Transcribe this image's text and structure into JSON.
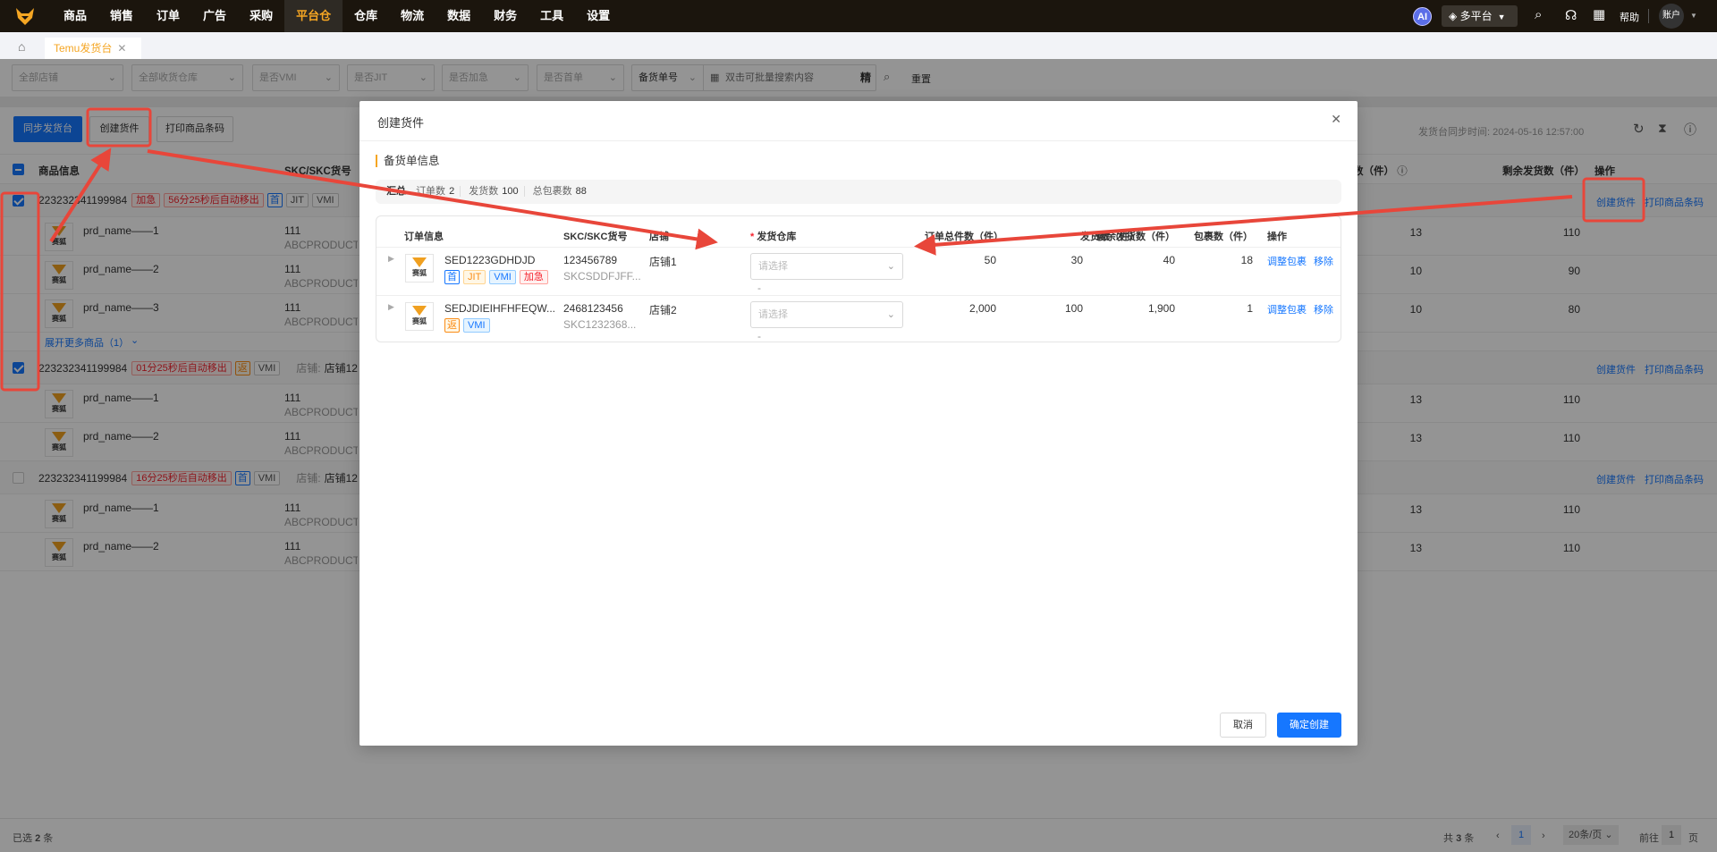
{
  "nav": {
    "logo": "saihu-fox-logo",
    "items": [
      "商品",
      "销售",
      "订单",
      "广告",
      "采购",
      "平台仓",
      "仓库",
      "物流",
      "数据",
      "财务",
      "工具",
      "设置"
    ],
    "active": "平台仓",
    "ai": "AI",
    "platform": "多平台",
    "help": "帮助",
    "account": "账户",
    "icons": [
      "search-icon",
      "headset-icon",
      "grid-icon"
    ]
  },
  "tabs": {
    "items": [
      {
        "label": "Temu发货台"
      }
    ]
  },
  "filters": {
    "shop": "全部店铺",
    "warehouse": "全部收货仓库",
    "vmi": "是否VMI",
    "jit": "是否JIT",
    "urgent": "是否加急",
    "first": "是否首单",
    "search_type": "备货单号",
    "search_placeholder": "双击可批量搜索内容",
    "exact": "精",
    "reset": "重置"
  },
  "toolbar": {
    "sync": "同步发货台",
    "create": "创建货件",
    "print": "打印商品条码",
    "sync_time_label": "发货台同步时间:",
    "sync_time": "2024-05-16 12:57:00"
  },
  "table": {
    "headers": {
      "product": "商品信息",
      "skc": "SKC/SKC货号",
      "ship": "发货数（件）",
      "remaining": "剩余发货数（件）",
      "ops": "操作"
    },
    "thumb_text": "赛狐",
    "groups": [
      {
        "order_id": "223232341199984",
        "checked": true,
        "tags": [
          {
            "text": "加急",
            "type": "red"
          },
          {
            "text": "56分25秒后自动移出",
            "type": "red"
          },
          {
            "text": "首",
            "type": "blue-sq"
          },
          {
            "text": "JIT",
            "type": "gray"
          },
          {
            "text": "VMI",
            "type": "gray"
          }
        ],
        "shop_label": "",
        "shop": "",
        "actions": [
          "创建货件",
          "打印商品条码"
        ],
        "products": [
          {
            "name": "prd_name——1",
            "skc": "111",
            "skc_code": "ABCPRODUCTS",
            "ship": "13",
            "remaining": "110"
          },
          {
            "name": "prd_name——2",
            "skc": "111",
            "skc_code": "ABCPRODUCTS",
            "ship": "10",
            "remaining": "90"
          },
          {
            "name": "prd_name——3",
            "skc": "111",
            "skc_code": "ABCPRODUCTS",
            "ship": "10",
            "remaining": "80"
          }
        ],
        "expand": "展开更多商品（1）"
      },
      {
        "order_id": "223232341199984",
        "checked": true,
        "tags": [
          {
            "text": "01分25秒后自动移出",
            "type": "red"
          },
          {
            "text": "返",
            "type": "orange-sq"
          },
          {
            "text": "VMI",
            "type": "gray"
          }
        ],
        "shop_label": "店铺:",
        "shop": "店铺12",
        "actions": [
          "创建货件",
          "打印商品条码"
        ],
        "products": [
          {
            "name": "prd_name——1",
            "skc": "111",
            "skc_code": "ABCPRODUCTS",
            "ship": "13",
            "remaining": "110"
          },
          {
            "name": "prd_name——2",
            "skc": "111",
            "skc_code": "ABCPRODUCTS",
            "ship": "13",
            "remaining": "110"
          }
        ]
      },
      {
        "order_id": "223232341199984",
        "checked": false,
        "tags": [
          {
            "text": "16分25秒后自动移出",
            "type": "red"
          },
          {
            "text": "首",
            "type": "blue-sq"
          },
          {
            "text": "VMI",
            "type": "gray"
          }
        ],
        "shop_label": "店铺:",
        "shop": "店铺12",
        "actions": [
          "创建货件",
          "打印商品条码"
        ],
        "products": [
          {
            "name": "prd_name——1",
            "skc": "111",
            "skc_code": "ABCPRODUCTS",
            "ship": "13",
            "remaining": "110"
          },
          {
            "name": "prd_name——2",
            "skc": "111",
            "skc_code": "ABCPRODUCTS",
            "ship": "13",
            "remaining": "110"
          }
        ]
      }
    ]
  },
  "footer": {
    "selected_prefix": "已选",
    "selected": "2",
    "selected_suffix": "条",
    "total_prefix": "共",
    "total": "3",
    "total_suffix": "条",
    "page": "1",
    "page_size": "20条/页",
    "goto": "前往",
    "goto_page": "1",
    "page_suffix": "页"
  },
  "modal": {
    "title": "创建货件",
    "section": "备货单信息",
    "summary": {
      "label": "汇总",
      "items": [
        {
          "label": "订单数",
          "value": "2"
        },
        {
          "label": "发货数",
          "value": "100"
        },
        {
          "label": "总包裹数",
          "value": "88"
        }
      ]
    },
    "headers": {
      "order": "订单信息",
      "skc": "SKC/SKC货号",
      "shop": "店铺",
      "warehouse_required": "*",
      "warehouse": "发货仓库",
      "total": "订单总件数（件）",
      "ship": "发货数（件）",
      "remaining": "剩余发货数（件）",
      "packages": "包裹数（件）",
      "ops": "操作"
    },
    "rows": [
      {
        "order": "SED1223GDHDJD",
        "tags": [
          {
            "text": "首",
            "type": "blue-sq"
          },
          {
            "text": "JIT",
            "type": "orange"
          },
          {
            "text": "VMI",
            "type": "blue"
          },
          {
            "text": "加急",
            "type": "red"
          }
        ],
        "skc": "123456789",
        "skc_code": "SKCSDDFJFF...",
        "shop": "店铺1",
        "warehouse_placeholder": "请选择",
        "warehouse_note": "-",
        "total": "50",
        "ship": "30",
        "remaining": "40",
        "packages": "18",
        "actions": [
          "调整包裹",
          "移除"
        ]
      },
      {
        "order": "SEDJDIEIHFHFEQW...",
        "tags": [
          {
            "text": "返",
            "type": "orange-sq"
          },
          {
            "text": "VMI",
            "type": "blue"
          }
        ],
        "skc": "2468123456",
        "skc_code": "SKC1232368...",
        "shop": "店铺2",
        "warehouse_placeholder": "请选择",
        "warehouse_note": "-",
        "total": "2,000",
        "ship": "100",
        "remaining": "1,900",
        "packages": "1",
        "actions": [
          "调整包裹",
          "移除"
        ]
      }
    ],
    "cancel": "取消",
    "confirm": "确定创建"
  },
  "colors": {
    "accent": "#f5a623",
    "primary": "#1677ff",
    "annotation": "#e8463a"
  }
}
